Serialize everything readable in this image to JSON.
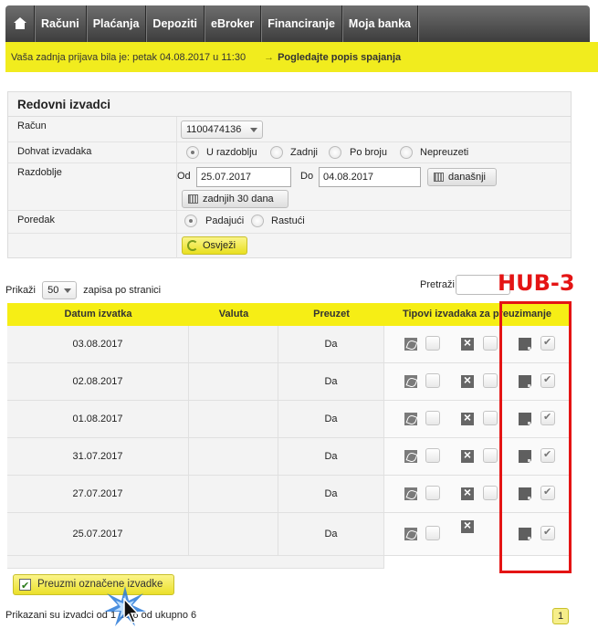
{
  "nav": {
    "home_icon": "home-icon",
    "items": [
      "Računi",
      "Plaćanja",
      "Depoziti",
      "eBroker",
      "Financiranje",
      "Moja banka"
    ]
  },
  "notice": {
    "last_login": "Vaša zadnja prijava bila je: petak 04.08.2017 u 11:30",
    "link": "Pogledajte popis spajanja"
  },
  "form": {
    "title": "Redovni izvadci",
    "account_label": "Račun",
    "account_value": "1100474136",
    "fetch_label": "Dohvat izvadaka",
    "fetch_options": [
      "U razdoblju",
      "Zadnji",
      "Po broju",
      "Nepreuzeti"
    ],
    "period_label": "Razdoblje",
    "from_label": "Od",
    "from_value": "25.07.2017",
    "to_label": "Do",
    "to_value": "04.08.2017",
    "today_button": "današnji",
    "last30_button": "zadnjih 30 dana",
    "order_label": "Poredak",
    "order_options": [
      "Padajući",
      "Rastući"
    ],
    "refresh_button": "Osvježi"
  },
  "table_controls": {
    "show_label": "Prikaži",
    "page_size": "50",
    "per_page_label": "zapisa po stranici",
    "search_label": "Pretraži"
  },
  "table": {
    "headers": [
      "Datum izvatka",
      "Valuta",
      "Preuzet",
      "Tipovi izvadaka za preuzimanje"
    ],
    "rows": [
      {
        "date": "03.08.2017",
        "currency": "",
        "downloaded": "Da"
      },
      {
        "date": "02.08.2017",
        "currency": "",
        "downloaded": "Da"
      },
      {
        "date": "01.08.2017",
        "currency": "",
        "downloaded": "Da"
      },
      {
        "date": "31.07.2017",
        "currency": "",
        "downloaded": "Da"
      },
      {
        "date": "27.07.2017",
        "currency": "",
        "downloaded": "Da"
      },
      {
        "date": "25.07.2017",
        "currency": "",
        "downloaded": "Da"
      }
    ]
  },
  "footer": {
    "download_button": "Preuzmi označene izvadke",
    "summary": "Prikazani su izvadci od 1 do 6 od ukupno 6",
    "current_page": "1"
  },
  "annotation": {
    "label": "HUB-3",
    "color": "#e41414"
  },
  "colors": {
    "accent_yellow": "#f6ee15",
    "nav_dark": "#3d3d3d"
  }
}
